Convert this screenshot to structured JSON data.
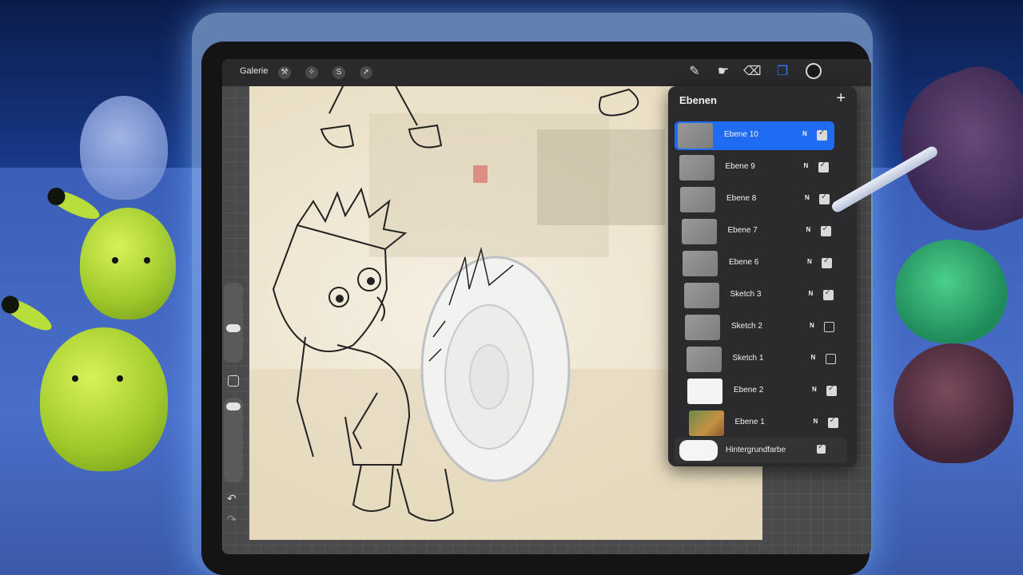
{
  "toolbar": {
    "gallery_label": "Galerie",
    "left_tools": [
      "wrench-icon",
      "magic-wand-icon",
      "selection-s-icon",
      "arrow-transform-icon"
    ],
    "right_tools": [
      "brush-icon",
      "smudge-icon",
      "eraser-icon",
      "layers-icon"
    ],
    "current_color": "#1a1a1a"
  },
  "layers_panel": {
    "title": "Ebenen",
    "add_label": "+",
    "layers": [
      {
        "name": "Ebene 10",
        "blend": "N",
        "visible": true,
        "selected": true
      },
      {
        "name": "Ebene 9",
        "blend": "N",
        "visible": true,
        "selected": false
      },
      {
        "name": "Ebene 8",
        "blend": "N",
        "visible": true,
        "selected": false
      },
      {
        "name": "Ebene 7",
        "blend": "N",
        "visible": true,
        "selected": false
      },
      {
        "name": "Ebene 6",
        "blend": "N",
        "visible": true,
        "selected": false
      },
      {
        "name": "Sketch 3",
        "blend": "N",
        "visible": true,
        "selected": false
      },
      {
        "name": "Sketch 2",
        "blend": "N",
        "visible": false,
        "selected": false
      },
      {
        "name": "Sketch 1",
        "blend": "N",
        "visible": false,
        "selected": false
      },
      {
        "name": "Ebene 2",
        "blend": "N",
        "visible": true,
        "selected": false
      },
      {
        "name": "Ebene 1",
        "blend": "N",
        "visible": true,
        "selected": false
      }
    ],
    "background": {
      "name": "Hintergrundfarbe",
      "visible": true
    }
  },
  "sidebar": {
    "undo_label": "↶",
    "redo_label": "↷"
  },
  "colors": {
    "accent": "#1f6cf2"
  }
}
